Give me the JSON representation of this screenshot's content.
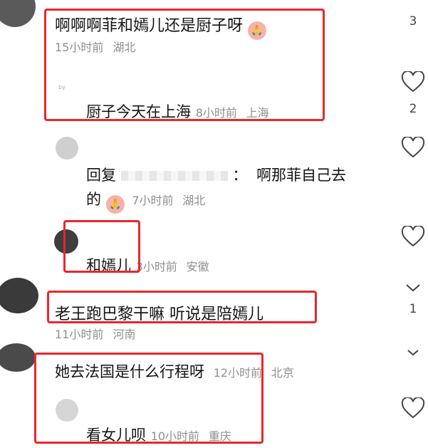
{
  "comments": [
    {
      "text": "啊啊啊菲和嫣儿还是厨子呀",
      "emoji": "pray-emoji",
      "time": "15小时前",
      "location": "湖北",
      "right_count": "3",
      "replies": [
        {
          "author_hint": "by",
          "text": "厨子今天在上海",
          "time": "8小时前",
          "location": "上海",
          "like_count": "2"
        },
        {
          "author_hint": "",
          "prefix": "回复",
          "suffix": "：",
          "text_line1": "啊那菲自己去",
          "text_line2": "的",
          "emoji": "pray-emoji",
          "time": "7小时前",
          "location": "湖北"
        },
        {
          "text": "和嫣儿",
          "time": "3小时前",
          "location": "安徽"
        }
      ]
    },
    {
      "text": "老王跑巴黎干嘛 听说是陪嫣儿",
      "time": "11小时前",
      "location": "河南",
      "right_count": "1"
    },
    {
      "text": "她去法国是什么行程呀",
      "time": "12小时前",
      "location": "北京",
      "replies": [
        {
          "text": "看女儿呗",
          "time": "10小时前",
          "location": "重庆"
        }
      ]
    }
  ],
  "colors": {
    "highlight": "#e8272c",
    "meta": "#8f8f8f",
    "text": "#141414"
  },
  "icons": [
    "heart-icon",
    "chevron-down-icon",
    "pray-emoji"
  ]
}
